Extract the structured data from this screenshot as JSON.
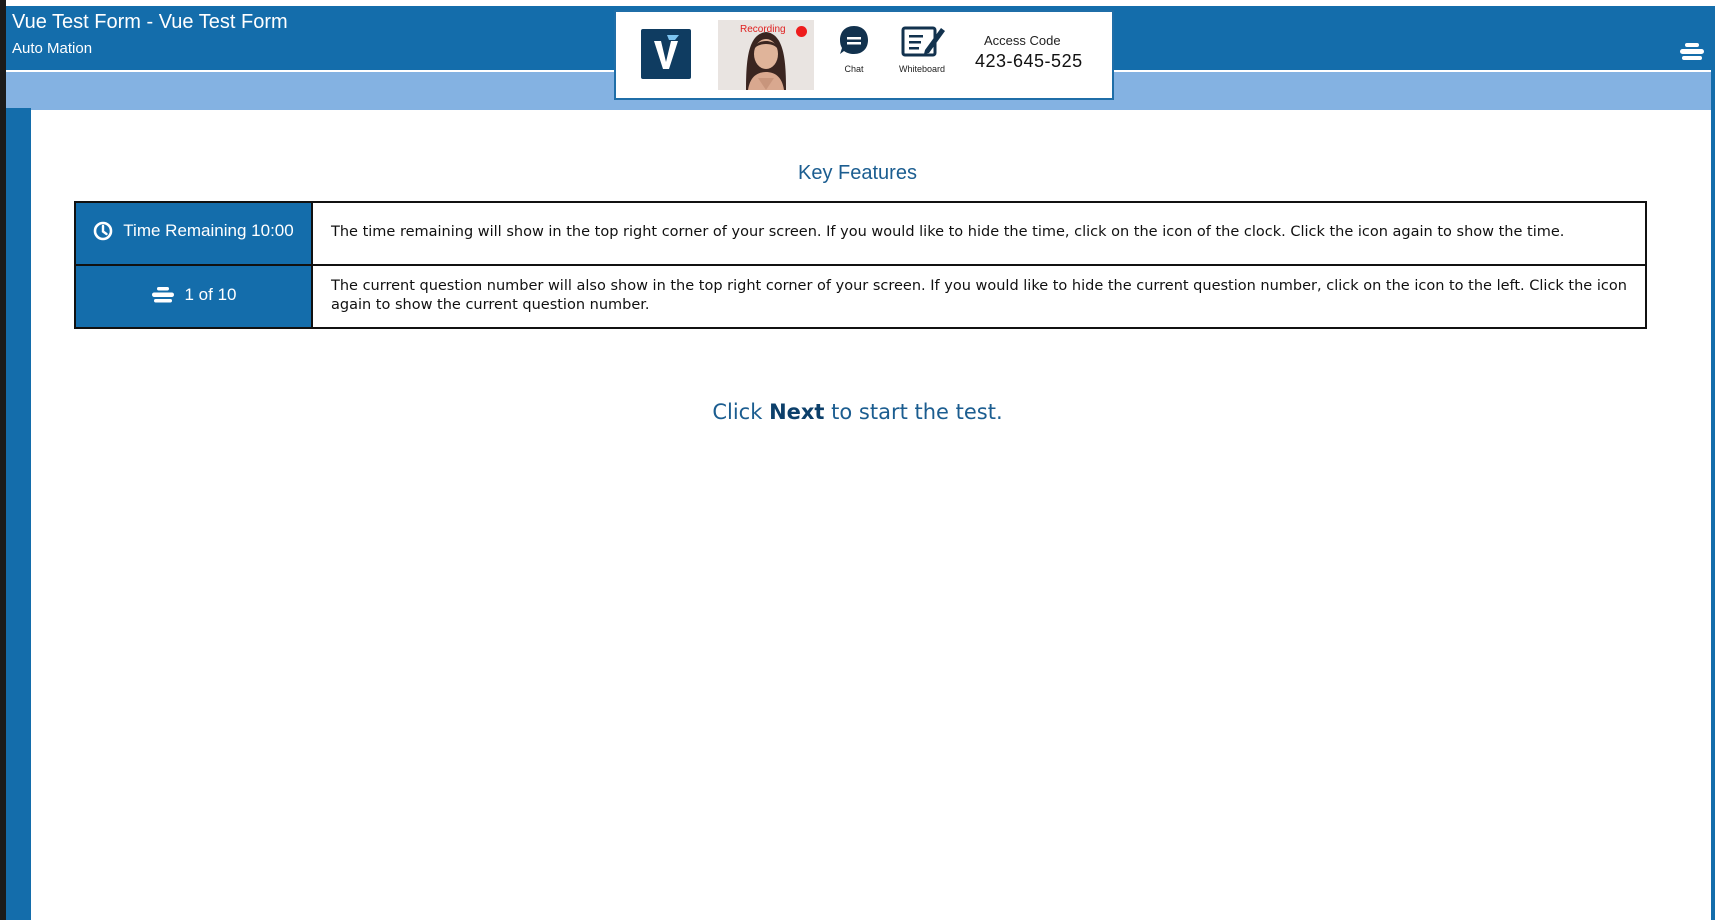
{
  "header": {
    "title": "Vue Test Form - Vue Test Form",
    "subtitle": "Auto Mation",
    "counter_icon": "stack-icon"
  },
  "proctor": {
    "logo_icon": "vue-logo-icon",
    "recording_label": "Recording",
    "chat_label": "Chat",
    "whiteboard_label": "Whiteboard",
    "access_label": "Access Code",
    "access_code": "423-645-525"
  },
  "content": {
    "title": "Key Features",
    "features": [
      {
        "icon": "clock-icon",
        "key": "Time Remaining 10:00",
        "description": "The time remaining will show in the top right corner of your screen. If you would like to hide the time, click on the icon of the clock. Click the icon again to show the time."
      },
      {
        "icon": "stack-icon",
        "key": "1 of 10",
        "description": "The current question number will also show in the top right corner of your screen. If you would like to hide the current question number, click on the icon to the left. Click the icon again to show the current question number."
      }
    ],
    "instruction_prefix": "Click ",
    "instruction_bold": "Next",
    "instruction_suffix": " to start the test."
  },
  "colors": {
    "header": "#146dab",
    "subbar": "#84b2e2",
    "title_text": "#1b5d90"
  }
}
